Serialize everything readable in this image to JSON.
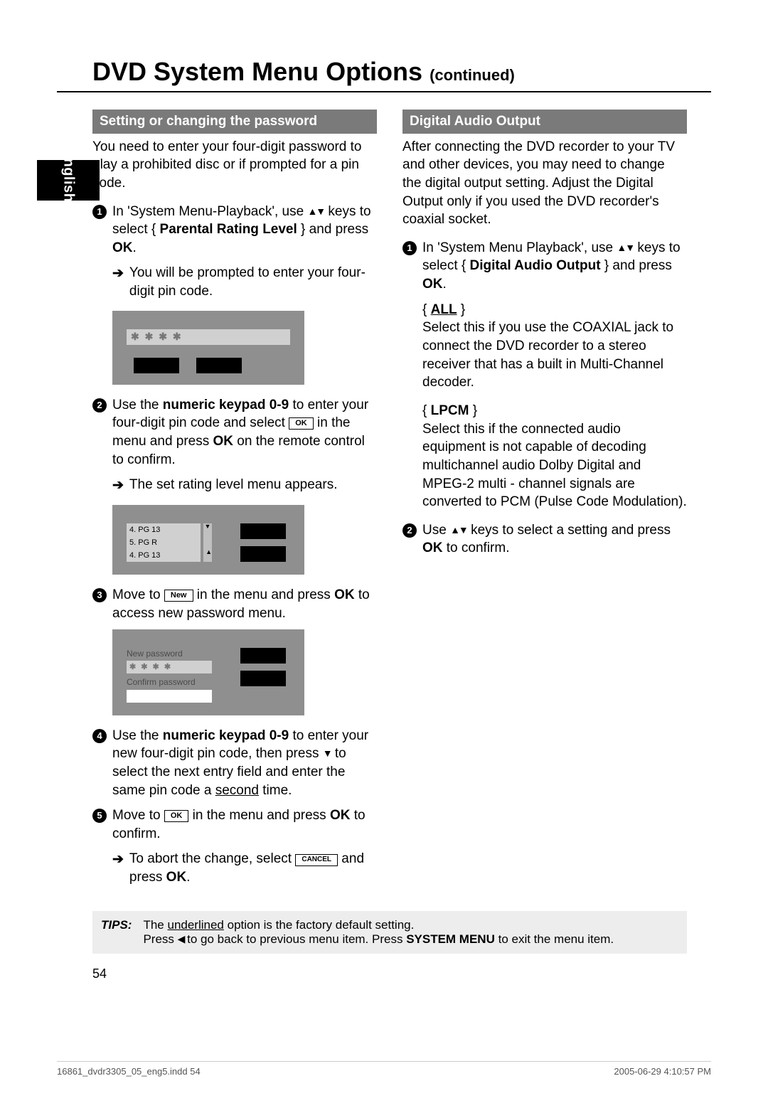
{
  "lang_tab": "English",
  "title_main": "DVD System Menu Options",
  "title_cont": "(continued)",
  "left": {
    "section": "Setting or changing the password",
    "intro": "You need to enter your four-digit password to play a prohibited disc or if prompted for a pin code.",
    "step1_pre": "In 'System Menu-Playback', use ",
    "step1_mid": " keys to select { ",
    "step1_bold": "Parental Rating Level",
    "step1_post": " } and press ",
    "ok": "OK",
    "step1_result": "You will be prompted to enter your four-digit pin code.",
    "scr1_mask": "✱ ✱ ✱ ✱",
    "step2_a": "Use the ",
    "step2_bold": "numeric keypad 0-9",
    "step2_b": " to enter your four-digit pin code and select ",
    "btn_ok": "OK",
    "step2_c": " in the menu and press ",
    "step2_d": " on the remote control to confirm.",
    "step2_result": "The set rating level menu appears.",
    "scr2_r1": "4.  PG 13",
    "scr2_r2": "5.  PG R",
    "scr2_r3": "4.  PG 13",
    "step3_a": "Move to ",
    "btn_new": "New",
    "step3_b": " in the menu and press ",
    "step3_c": " to access new password menu.",
    "scr3_l1": "New password",
    "scr3_mask": "✱ ✱ ✱ ✱",
    "scr3_l2": "Confirm password",
    "step4_a": "Use the ",
    "step4_b": " to enter your new four-digit pin code, then press ",
    "step4_c": " to select the next entry field and enter the same pin code a ",
    "step4_ul": "second",
    "step4_d": " time.",
    "step5_a": "Move to ",
    "step5_b": " in the menu and press ",
    "step5_c": " to confirm.",
    "step5_abort_a": "To abort the change, select ",
    "btn_cancel": "CANCEL",
    "step5_abort_b": " and press "
  },
  "right": {
    "section": "Digital Audio Output",
    "intro": "After connecting the DVD recorder to your TV and other devices, you may need to change the digital output setting. Adjust the Digital Output only if you used the DVD recorder's coaxial socket.",
    "step1_pre": "In 'System Menu Playback', use ",
    "step1_mid": " keys to select { ",
    "step1_bold": "Digital Audio Output",
    "step1_post": " } and press ",
    "opt_all_name": "ALL",
    "opt_all_desc": "Select this if you use the COAXIAL jack to connect the DVD recorder to a stereo receiver that has a built in Multi-Channel decoder.",
    "opt_lpcm_name": "LPCM",
    "opt_lpcm_desc": "Select this if the connected audio equipment is not capable of decoding multichannel audio Dolby Digital and MPEG-2 multi - channel signals are converted to PCM (Pulse Code Modulation).",
    "step2_a": "Use ",
    "step2_b": " keys to select a setting and press ",
    "step2_c": " to confirm."
  },
  "tips": {
    "label": "TIPS:",
    "line1_a": "The ",
    "line1_ul": "underlined",
    "line1_b": " option is the factory default setting.",
    "line2_a": "Press ",
    "line2_b": " to go back to previous menu item. Press ",
    "line2_bold": "SYSTEM MENU",
    "line2_c": " to exit the menu item."
  },
  "page_num": "54",
  "footer_left": "16861_dvdr3305_05_eng5.indd   54",
  "footer_right": "2005-06-29   4:10:57 PM",
  "icons": {
    "updown": "▲▼",
    "down": "▼",
    "left": "◀",
    "rarrow": "➔"
  }
}
